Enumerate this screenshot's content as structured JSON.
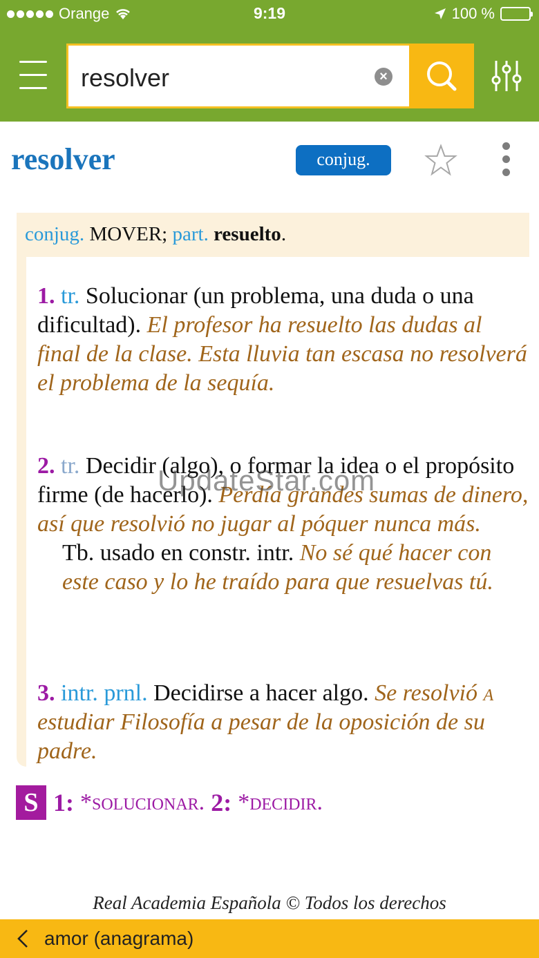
{
  "status_bar": {
    "carrier": "Orange",
    "time": "9:19",
    "battery": "100 %"
  },
  "search": {
    "query": "resolver"
  },
  "entry": {
    "headword": "resolver",
    "conj_badge": "conjug.",
    "conj_label": "conjug.",
    "conj_model": "MOVER;",
    "part_label": "part.",
    "participle": "resuelto",
    "senses": [
      {
        "num": "1.",
        "abbr": "tr.",
        "definition": "Solucionar (un problema, una duda o una dificultad).",
        "example": "El profesor ha resuelto las dudas al final de la clase. Esta lluvia tan escasa no resolverá el problema de la sequía."
      },
      {
        "num": "2.",
        "abbr": "tr.",
        "definition": "Decidir (algo), o formar la idea o el propósito firme (de hacerlo).",
        "example": "Perdía grandes sumas de dinero, así que resolvió no jugar al póquer nunca más.",
        "note": "Tb. usado en constr. intr.",
        "note_example": "No sé qué hacer con este caso y lo he traído para que resuelvas tú."
      },
      {
        "num": "3.",
        "abbr": "intr. prnl.",
        "definition": "Decidirse a hacer algo.",
        "example_a": "Se resolvió",
        "example_prep": "a",
        "example_b": "estudiar Filosofía a pesar de la oposición de su padre."
      }
    ],
    "synonyms": {
      "badge": "S",
      "items": [
        {
          "num": "1:",
          "word": "*solucionar."
        },
        {
          "num": "2:",
          "word": "*decidir."
        }
      ]
    }
  },
  "watermark": "UpdateStar.com",
  "copyright": "Real Academia Española © Todos los derechos",
  "bottom_bar": {
    "label": "amor (anagrama)"
  },
  "colors": {
    "nav_green": "#78a82f",
    "search_yellow": "#f8b813",
    "headword_blue": "#1b75bc",
    "sense_purple": "#9c1aa4",
    "example_brown": "#a0651b"
  }
}
